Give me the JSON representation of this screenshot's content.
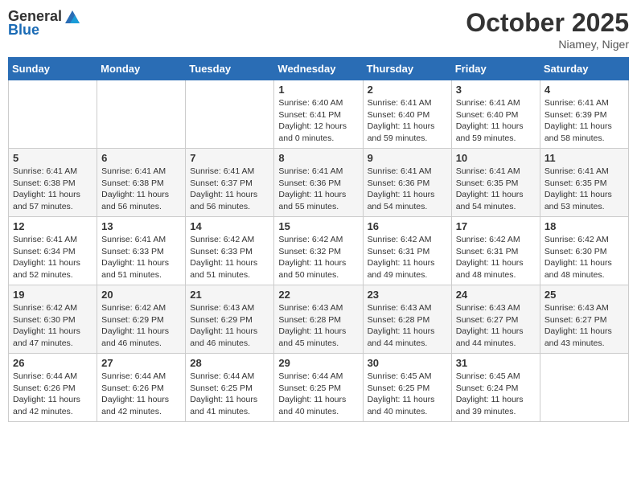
{
  "logo": {
    "text_general": "General",
    "text_blue": "Blue"
  },
  "title": "October 2025",
  "location": "Niamey, Niger",
  "days_of_week": [
    "Sunday",
    "Monday",
    "Tuesday",
    "Wednesday",
    "Thursday",
    "Friday",
    "Saturday"
  ],
  "weeks": [
    [
      {
        "day": "",
        "sunrise": "",
        "sunset": "",
        "daylight": ""
      },
      {
        "day": "",
        "sunrise": "",
        "sunset": "",
        "daylight": ""
      },
      {
        "day": "",
        "sunrise": "",
        "sunset": "",
        "daylight": ""
      },
      {
        "day": "1",
        "sunrise": "Sunrise: 6:40 AM",
        "sunset": "Sunset: 6:41 PM",
        "daylight": "Daylight: 12 hours and 0 minutes."
      },
      {
        "day": "2",
        "sunrise": "Sunrise: 6:41 AM",
        "sunset": "Sunset: 6:40 PM",
        "daylight": "Daylight: 11 hours and 59 minutes."
      },
      {
        "day": "3",
        "sunrise": "Sunrise: 6:41 AM",
        "sunset": "Sunset: 6:40 PM",
        "daylight": "Daylight: 11 hours and 59 minutes."
      },
      {
        "day": "4",
        "sunrise": "Sunrise: 6:41 AM",
        "sunset": "Sunset: 6:39 PM",
        "daylight": "Daylight: 11 hours and 58 minutes."
      }
    ],
    [
      {
        "day": "5",
        "sunrise": "Sunrise: 6:41 AM",
        "sunset": "Sunset: 6:38 PM",
        "daylight": "Daylight: 11 hours and 57 minutes."
      },
      {
        "day": "6",
        "sunrise": "Sunrise: 6:41 AM",
        "sunset": "Sunset: 6:38 PM",
        "daylight": "Daylight: 11 hours and 56 minutes."
      },
      {
        "day": "7",
        "sunrise": "Sunrise: 6:41 AM",
        "sunset": "Sunset: 6:37 PM",
        "daylight": "Daylight: 11 hours and 56 minutes."
      },
      {
        "day": "8",
        "sunrise": "Sunrise: 6:41 AM",
        "sunset": "Sunset: 6:36 PM",
        "daylight": "Daylight: 11 hours and 55 minutes."
      },
      {
        "day": "9",
        "sunrise": "Sunrise: 6:41 AM",
        "sunset": "Sunset: 6:36 PM",
        "daylight": "Daylight: 11 hours and 54 minutes."
      },
      {
        "day": "10",
        "sunrise": "Sunrise: 6:41 AM",
        "sunset": "Sunset: 6:35 PM",
        "daylight": "Daylight: 11 hours and 54 minutes."
      },
      {
        "day": "11",
        "sunrise": "Sunrise: 6:41 AM",
        "sunset": "Sunset: 6:35 PM",
        "daylight": "Daylight: 11 hours and 53 minutes."
      }
    ],
    [
      {
        "day": "12",
        "sunrise": "Sunrise: 6:41 AM",
        "sunset": "Sunset: 6:34 PM",
        "daylight": "Daylight: 11 hours and 52 minutes."
      },
      {
        "day": "13",
        "sunrise": "Sunrise: 6:41 AM",
        "sunset": "Sunset: 6:33 PM",
        "daylight": "Daylight: 11 hours and 51 minutes."
      },
      {
        "day": "14",
        "sunrise": "Sunrise: 6:42 AM",
        "sunset": "Sunset: 6:33 PM",
        "daylight": "Daylight: 11 hours and 51 minutes."
      },
      {
        "day": "15",
        "sunrise": "Sunrise: 6:42 AM",
        "sunset": "Sunset: 6:32 PM",
        "daylight": "Daylight: 11 hours and 50 minutes."
      },
      {
        "day": "16",
        "sunrise": "Sunrise: 6:42 AM",
        "sunset": "Sunset: 6:31 PM",
        "daylight": "Daylight: 11 hours and 49 minutes."
      },
      {
        "day": "17",
        "sunrise": "Sunrise: 6:42 AM",
        "sunset": "Sunset: 6:31 PM",
        "daylight": "Daylight: 11 hours and 48 minutes."
      },
      {
        "day": "18",
        "sunrise": "Sunrise: 6:42 AM",
        "sunset": "Sunset: 6:30 PM",
        "daylight": "Daylight: 11 hours and 48 minutes."
      }
    ],
    [
      {
        "day": "19",
        "sunrise": "Sunrise: 6:42 AM",
        "sunset": "Sunset: 6:30 PM",
        "daylight": "Daylight: 11 hours and 47 minutes."
      },
      {
        "day": "20",
        "sunrise": "Sunrise: 6:42 AM",
        "sunset": "Sunset: 6:29 PM",
        "daylight": "Daylight: 11 hours and 46 minutes."
      },
      {
        "day": "21",
        "sunrise": "Sunrise: 6:43 AM",
        "sunset": "Sunset: 6:29 PM",
        "daylight": "Daylight: 11 hours and 46 minutes."
      },
      {
        "day": "22",
        "sunrise": "Sunrise: 6:43 AM",
        "sunset": "Sunset: 6:28 PM",
        "daylight": "Daylight: 11 hours and 45 minutes."
      },
      {
        "day": "23",
        "sunrise": "Sunrise: 6:43 AM",
        "sunset": "Sunset: 6:28 PM",
        "daylight": "Daylight: 11 hours and 44 minutes."
      },
      {
        "day": "24",
        "sunrise": "Sunrise: 6:43 AM",
        "sunset": "Sunset: 6:27 PM",
        "daylight": "Daylight: 11 hours and 44 minutes."
      },
      {
        "day": "25",
        "sunrise": "Sunrise: 6:43 AM",
        "sunset": "Sunset: 6:27 PM",
        "daylight": "Daylight: 11 hours and 43 minutes."
      }
    ],
    [
      {
        "day": "26",
        "sunrise": "Sunrise: 6:44 AM",
        "sunset": "Sunset: 6:26 PM",
        "daylight": "Daylight: 11 hours and 42 minutes."
      },
      {
        "day": "27",
        "sunrise": "Sunrise: 6:44 AM",
        "sunset": "Sunset: 6:26 PM",
        "daylight": "Daylight: 11 hours and 42 minutes."
      },
      {
        "day": "28",
        "sunrise": "Sunrise: 6:44 AM",
        "sunset": "Sunset: 6:25 PM",
        "daylight": "Daylight: 11 hours and 41 minutes."
      },
      {
        "day": "29",
        "sunrise": "Sunrise: 6:44 AM",
        "sunset": "Sunset: 6:25 PM",
        "daylight": "Daylight: 11 hours and 40 minutes."
      },
      {
        "day": "30",
        "sunrise": "Sunrise: 6:45 AM",
        "sunset": "Sunset: 6:25 PM",
        "daylight": "Daylight: 11 hours and 40 minutes."
      },
      {
        "day": "31",
        "sunrise": "Sunrise: 6:45 AM",
        "sunset": "Sunset: 6:24 PM",
        "daylight": "Daylight: 11 hours and 39 minutes."
      },
      {
        "day": "",
        "sunrise": "",
        "sunset": "",
        "daylight": ""
      }
    ]
  ]
}
